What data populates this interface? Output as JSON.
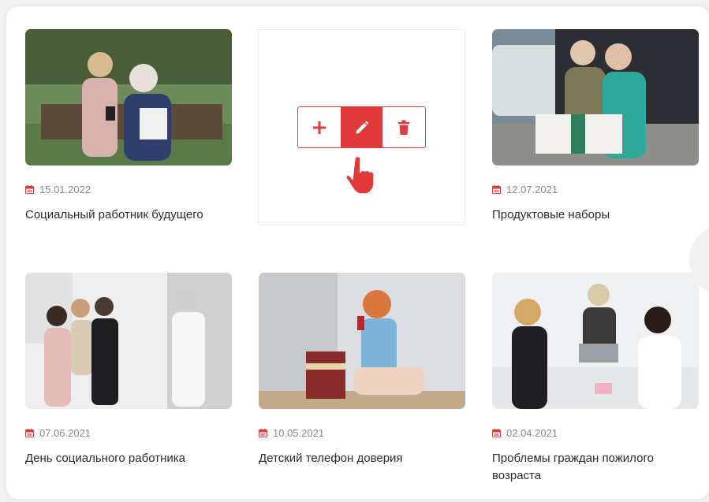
{
  "colors": {
    "accent": "#e03a3a",
    "date_text": "#8a8a8a",
    "title_text": "#2b2b2b"
  },
  "toolbar": {
    "buttons": [
      {
        "icon": "plus-icon",
        "label": "+"
      },
      {
        "icon": "pencil-icon",
        "label": "edit",
        "active": true
      },
      {
        "icon": "trash-icon",
        "label": "delete"
      }
    ],
    "cursor_icon": "hand-pointer-icon"
  },
  "cards": [
    {
      "date": "15.01.2022",
      "title": "Социальный работник будущего"
    },
    {
      "date": "12.07.2021",
      "title": "Продуктовые наборы"
    },
    {
      "date": "07.06.2021",
      "title": "День социального работника"
    },
    {
      "date": "10.05.2021",
      "title": "Детский телефон доверия"
    },
    {
      "date": "02.04.2021",
      "title": "Проблемы граждан пожилого возраста"
    }
  ]
}
